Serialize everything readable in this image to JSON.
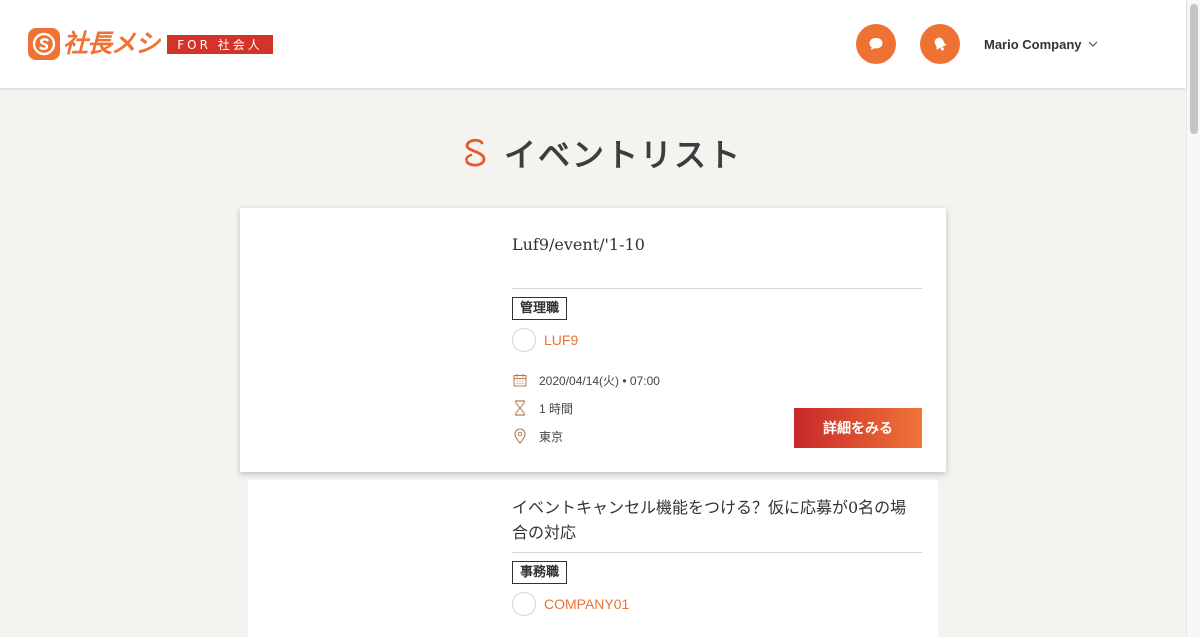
{
  "header": {
    "logo_text": "社長メシ",
    "logo_badge": "FOR 社会人",
    "chat_button_icon": "chat-bubble-icon",
    "notification_button_icon": "bell-icon",
    "company_name": "Mario Company"
  },
  "page": {
    "title": "イベントリスト"
  },
  "events": [
    {
      "title": "Luf9/event/'1-10",
      "tag": "管理職",
      "company": "LUF9",
      "datetime": "2020/04/14(火) • 07:00",
      "duration": "1 時間",
      "location": "東京",
      "detail_button": "詳細をみる"
    },
    {
      "title": "イベントキャンセル機能をつける？仮に応募が0名の場合の対応",
      "tag": "事務職",
      "company": "COMPANY01"
    }
  ],
  "colors": {
    "accent": "#ee7234",
    "badge": "#d3342a",
    "page_bg": "#f4f3f0"
  }
}
